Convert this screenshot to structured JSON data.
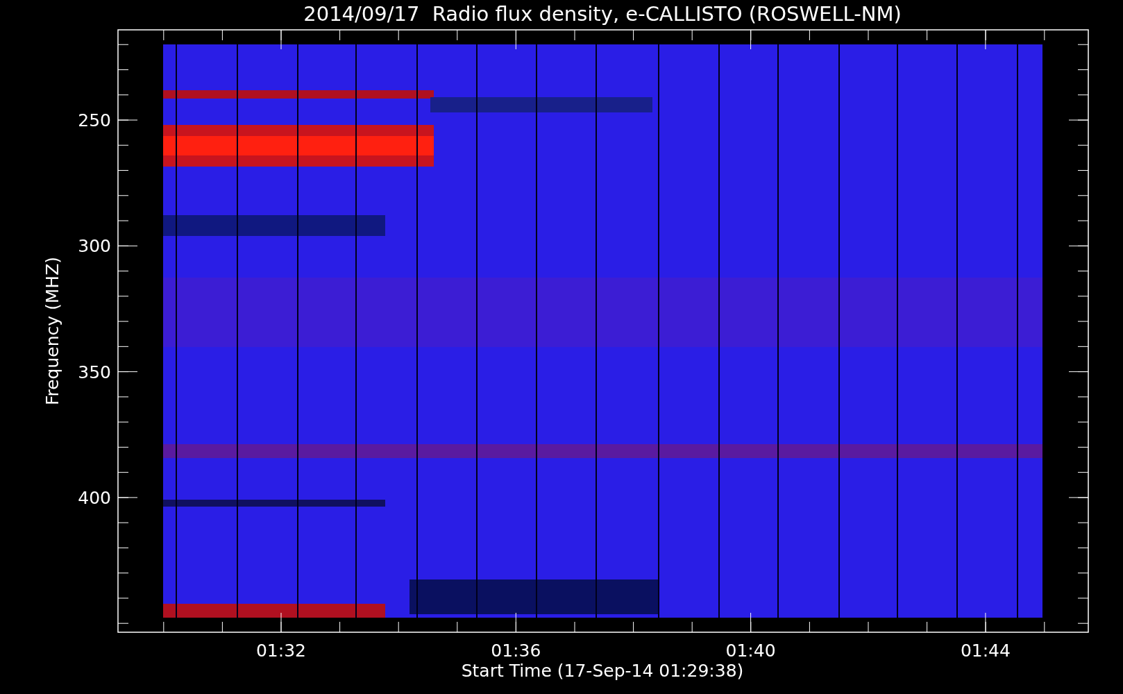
{
  "title": "2014/09/17  Radio flux density, e-CALLISTO (ROSWELL-NM)",
  "y_axis": {
    "label": "Frequency (MHZ)",
    "ticks": [
      "250",
      "300",
      "350",
      "400"
    ]
  },
  "x_axis": {
    "label": "Start Time (17-Sep-14 01:29:38)",
    "ticks": [
      "01:32",
      "01:36",
      "01:40",
      "01:44"
    ]
  }
}
